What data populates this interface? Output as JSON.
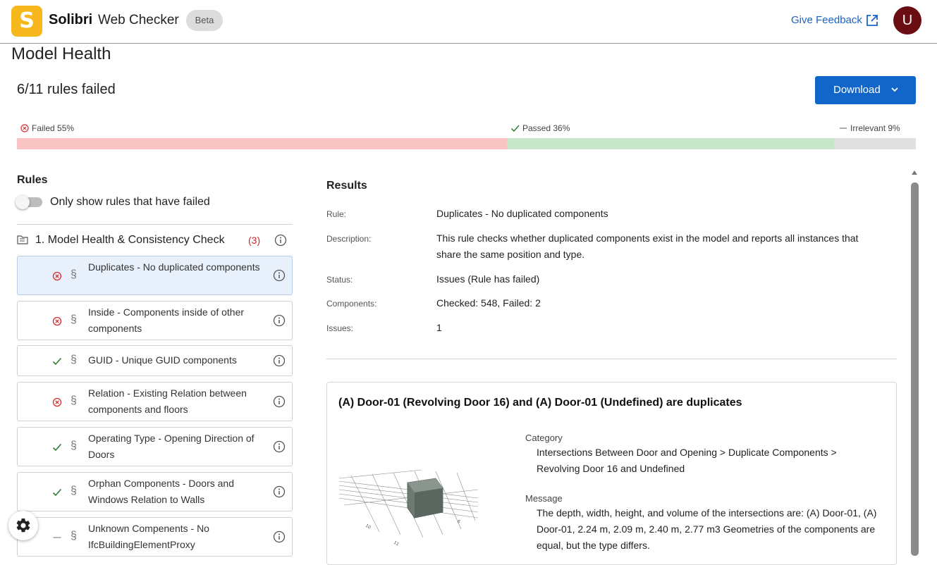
{
  "app": {
    "logo_letter": "S",
    "brand": "Solibri",
    "product": "Web Checker",
    "badge": "Beta",
    "feedback_label": "Give Feedback",
    "user_initial": "U"
  },
  "page": {
    "title": "Model Health",
    "summary": "6/11 rules failed",
    "download_label": "Download"
  },
  "progress": {
    "failed_label": "Failed 55%",
    "passed_label": "Passed 36%",
    "irrelevant_label": "Irrelevant 9%",
    "failed_pct": 54.5,
    "passed_pct": 36.4,
    "irrelevant_pct": 9.1,
    "colors": {
      "failed": "#f9c4c4",
      "passed": "#c8e6c9",
      "irrelevant": "#e0e0e0"
    }
  },
  "rules_panel": {
    "title": "Rules",
    "toggle_label": "Only show rules that have failed",
    "group": {
      "name": "1. Model Health & Consistency Check",
      "count": "(3)"
    },
    "para_symbol": "§",
    "items": [
      {
        "name": "Duplicates - No duplicated components",
        "status": "failed"
      },
      {
        "name": "Inside - Components inside of other components",
        "status": "failed"
      },
      {
        "name": "GUID - Unique GUID components",
        "status": "passed"
      },
      {
        "name": "Relation - Existing Relation between components and floors",
        "status": "failed"
      },
      {
        "name": "Operating Type - Opening Direction of Doors",
        "status": "passed"
      },
      {
        "name": "Orphan Components - Doors and Windows Relation to Walls",
        "status": "passed"
      },
      {
        "name": "Unknown Compenents - No IfcBuildingElementProxy",
        "status": "irrelevant"
      }
    ]
  },
  "results": {
    "title": "Results",
    "rule_label": "Rule:",
    "rule_value": "Duplicates - No duplicated components",
    "description_label": "Description:",
    "description_value": "This rule checks whether duplicated components exist in the model and reports all instances that share the same position and type.",
    "status_label": "Status:",
    "status_value": "Issues (Rule has failed)",
    "components_label": "Components:",
    "components_value": "Checked: 548, Failed: 2",
    "issues_label": "Issues:",
    "issues_value": "1"
  },
  "issue": {
    "title": "(A) Door-01 (Revolving Door 16) and (A) Door-01 (Undefined) are duplicates",
    "category_label": "Category",
    "category_value": "Intersections Between Door and Opening > Duplicate Components > Revolving Door 16 and Undefined",
    "message_label": "Message",
    "message_value": "The depth, width, height, and volume of the intersections are: (A) Door-01, (A) Door-01, 2.24 m, 2.09 m, 2.40 m, 2.77 m3  Geometries of the components are equal, but the type differs."
  }
}
